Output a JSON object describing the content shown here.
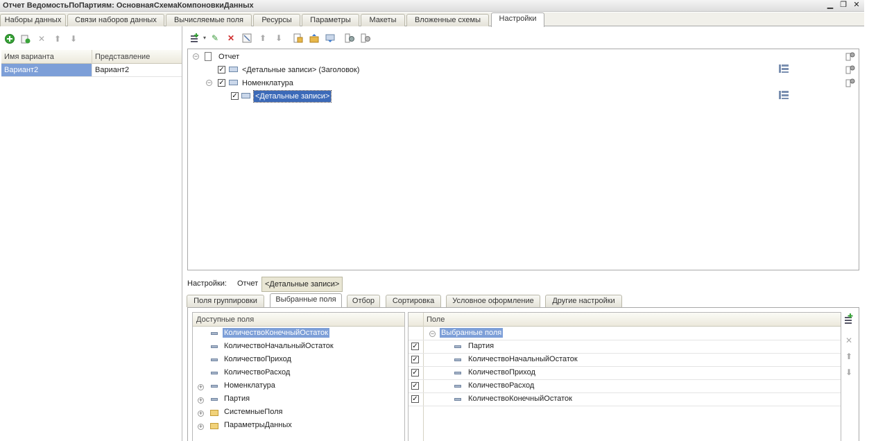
{
  "window": {
    "title": "Отчет ВедомостьПоПартиям: ОсновнаяСхемаКомпоновкиДанных",
    "minimize_glyph": "▁",
    "restore_glyph": "❐",
    "close_glyph": "✕"
  },
  "top_tabs": [
    {
      "label": "Наборы данных"
    },
    {
      "label": "Связи наборов данных"
    },
    {
      "label": "Вычисляемые поля"
    },
    {
      "label": "Ресурсы"
    },
    {
      "label": "Параметры"
    },
    {
      "label": "Макеты"
    },
    {
      "label": "Вложенные схемы"
    },
    {
      "label": "Настройки",
      "active": true
    }
  ],
  "variants": {
    "columns": [
      "Имя варианта",
      "Представление"
    ],
    "rows": [
      [
        "Вариант2",
        "Вариант2"
      ]
    ]
  },
  "structure_tree": {
    "root": "Отчет",
    "nodes": [
      {
        "label": "<Детальные записи> (Заголовок)",
        "checked": true
      },
      {
        "label": "Номенклатура",
        "checked": true
      },
      {
        "label": "<Детальные записи>",
        "checked": true,
        "selected": true
      }
    ]
  },
  "settings_bar": {
    "label": "Настройки:",
    "report": "Отчет",
    "current": "<Детальные записи>"
  },
  "bottom_tabs": [
    {
      "label": "Поля группировки"
    },
    {
      "label": "Выбранные поля",
      "active": true
    },
    {
      "label": "Отбор"
    },
    {
      "label": "Сортировка"
    },
    {
      "label": "Условное оформление"
    },
    {
      "label": "Другие настройки"
    }
  ],
  "available_fields": {
    "header": "Доступные поля",
    "items": [
      {
        "label": "КоличествоКонечныйОстаток",
        "kind": "field",
        "selected": true
      },
      {
        "label": "КоличествоНачальныйОстаток",
        "kind": "field"
      },
      {
        "label": "КоличествоПриход",
        "kind": "field"
      },
      {
        "label": "КоличествоРасход",
        "kind": "field"
      },
      {
        "label": "Номенклатура",
        "kind": "expandable-field"
      },
      {
        "label": "Партия",
        "kind": "expandable-field"
      },
      {
        "label": "СистемныеПоля",
        "kind": "folder"
      },
      {
        "label": "ПараметрыДанных",
        "kind": "folder"
      }
    ]
  },
  "selected_fields": {
    "header": "Поле",
    "group": "Выбранные поля",
    "items": [
      {
        "label": "Партия",
        "checked": true
      },
      {
        "label": "КоличествоНачальныйОстаток",
        "checked": true
      },
      {
        "label": "КоличествоПриход",
        "checked": true
      },
      {
        "label": "КоличествоРасход",
        "checked": true
      },
      {
        "label": "КоличествоКонечныйОстаток",
        "checked": true
      }
    ]
  },
  "colors": {
    "selection": "#7d9fd8",
    "highlight": "#3c6ab8",
    "add_green": "#3aa33a",
    "delete_red": "#d03030"
  }
}
